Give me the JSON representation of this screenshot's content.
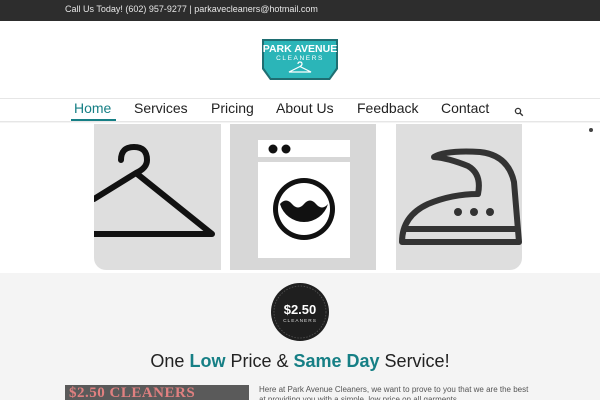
{
  "topbar": {
    "contact_text": "Call Us Today! (602) 957-9277 | parkavecleaners@hotmail.com"
  },
  "logo": {
    "line1": "PARK AVENUE",
    "line2": "CLEANERS"
  },
  "nav": {
    "items": [
      {
        "label": "Home",
        "active": true
      },
      {
        "label": "Services",
        "active": false
      },
      {
        "label": "Pricing",
        "active": false
      },
      {
        "label": "About Us",
        "active": false
      },
      {
        "label": "Feedback",
        "active": false
      },
      {
        "label": "Contact",
        "active": false
      }
    ],
    "search_icon": "search-icon"
  },
  "slider": {
    "slides": [
      "hanger-icon",
      "washing-machine-icon",
      "iron-icon"
    ],
    "slide_count": 4,
    "active_slide": 2
  },
  "badge": {
    "price": "$2.50",
    "label": "CLEANERS"
  },
  "headline": {
    "part1": "One ",
    "highlight1": "Low",
    "part2": " Price & ",
    "highlight2": "Same Day",
    "part3": " Service!"
  },
  "photo": {
    "sign_text": "$2.50 CLEANERS"
  },
  "intro": {
    "text": "Here at Park Avenue Cleaners, we want to prove to you that we are the best at providing you with a simple, low price on all garments."
  },
  "colors": {
    "accent": "#167f85",
    "logo_bg": "#2bb5b8",
    "topbar_bg": "#2d2d2d"
  }
}
